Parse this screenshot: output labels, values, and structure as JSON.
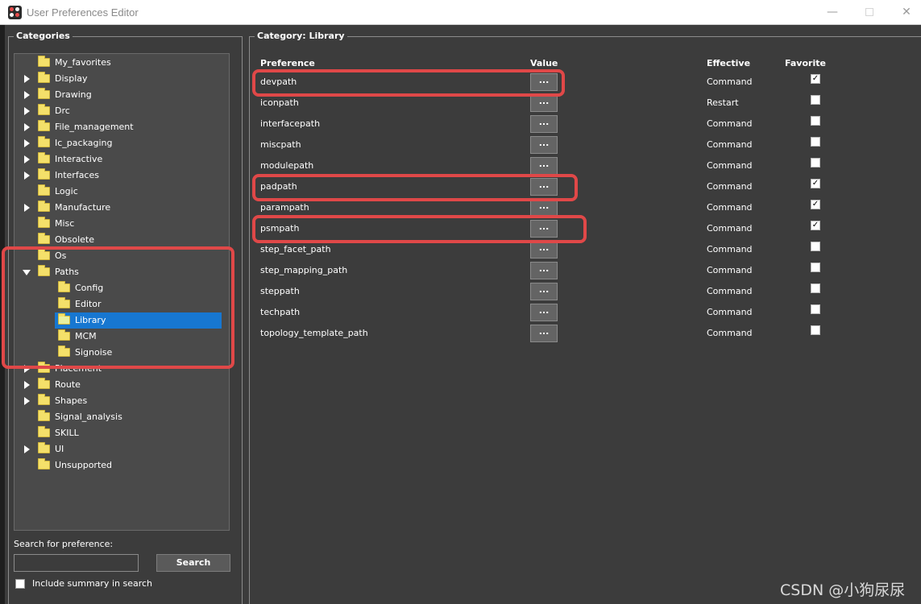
{
  "window": {
    "title": "User Preferences Editor",
    "minimize_glyph": "—",
    "close_glyph": "✕"
  },
  "categories_group": {
    "title": "Categories",
    "tree": [
      {
        "label": "My_favorites",
        "level": 0,
        "expander": "none"
      },
      {
        "label": "Display",
        "level": 0,
        "expander": "collapsed"
      },
      {
        "label": "Drawing",
        "level": 0,
        "expander": "collapsed"
      },
      {
        "label": "Drc",
        "level": 0,
        "expander": "collapsed"
      },
      {
        "label": "File_management",
        "level": 0,
        "expander": "collapsed"
      },
      {
        "label": "Ic_packaging",
        "level": 0,
        "expander": "collapsed"
      },
      {
        "label": "Interactive",
        "level": 0,
        "expander": "collapsed"
      },
      {
        "label": "Interfaces",
        "level": 0,
        "expander": "collapsed"
      },
      {
        "label": "Logic",
        "level": 0,
        "expander": "none"
      },
      {
        "label": "Manufacture",
        "level": 0,
        "expander": "collapsed"
      },
      {
        "label": "Misc",
        "level": 0,
        "expander": "none"
      },
      {
        "label": "Obsolete",
        "level": 0,
        "expander": "none"
      },
      {
        "label": "Os",
        "level": 0,
        "expander": "none"
      },
      {
        "label": "Paths",
        "level": 0,
        "expander": "expanded"
      },
      {
        "label": "Config",
        "level": 1,
        "expander": "none"
      },
      {
        "label": "Editor",
        "level": 1,
        "expander": "none"
      },
      {
        "label": "Library",
        "level": 1,
        "expander": "none",
        "selected": true
      },
      {
        "label": "MCM",
        "level": 1,
        "expander": "none"
      },
      {
        "label": "Signoise",
        "level": 1,
        "expander": "none"
      },
      {
        "label": "Placement",
        "level": 0,
        "expander": "collapsed"
      },
      {
        "label": "Route",
        "level": 0,
        "expander": "collapsed"
      },
      {
        "label": "Shapes",
        "level": 0,
        "expander": "collapsed"
      },
      {
        "label": "Signal_analysis",
        "level": 0,
        "expander": "none"
      },
      {
        "label": "SKILL",
        "level": 0,
        "expander": "none"
      },
      {
        "label": "UI",
        "level": 0,
        "expander": "collapsed"
      },
      {
        "label": "Unsupported",
        "level": 0,
        "expander": "none"
      }
    ],
    "search_label": "Search for preference:",
    "search_value": "",
    "search_button": "Search",
    "include_summary_label": "Include summary in search",
    "include_summary_checked": false
  },
  "category_group": {
    "title": "Category:  Library",
    "columns": {
      "preference": "Preference",
      "value": "Value",
      "effective": "Effective",
      "favorite": "Favorite"
    },
    "rows": [
      {
        "name": "devpath",
        "value_button": "...",
        "effective": "Command",
        "favorite": true,
        "highlighted": true
      },
      {
        "name": "iconpath",
        "value_button": "...",
        "effective": "Restart",
        "favorite": false
      },
      {
        "name": "interfacepath",
        "value_button": "...",
        "effective": "Command",
        "favorite": false
      },
      {
        "name": "miscpath",
        "value_button": "...",
        "effective": "Command",
        "favorite": false
      },
      {
        "name": "modulepath",
        "value_button": "...",
        "effective": "Command",
        "favorite": false
      },
      {
        "name": "padpath",
        "value_button": "...",
        "effective": "Command",
        "favorite": true,
        "highlighted": true
      },
      {
        "name": "parampath",
        "value_button": "...",
        "effective": "Command",
        "favorite": true
      },
      {
        "name": "psmpath",
        "value_button": "...",
        "effective": "Command",
        "favorite": true,
        "highlighted": true
      },
      {
        "name": "step_facet_path",
        "value_button": "...",
        "effective": "Command",
        "favorite": false
      },
      {
        "name": "step_mapping_path",
        "value_button": "...",
        "effective": "Command",
        "favorite": false
      },
      {
        "name": "steppath",
        "value_button": "...",
        "effective": "Command",
        "favorite": false
      },
      {
        "name": "techpath",
        "value_button": "...",
        "effective": "Command",
        "favorite": false
      },
      {
        "name": "topology_template_path",
        "value_button": "...",
        "effective": "Command",
        "favorite": false
      }
    ]
  },
  "watermark": "CSDN @小狗尿尿",
  "colors": {
    "background": "#3c3c3c",
    "tree_background": "#4a4a4a",
    "selection": "#1777d1",
    "highlight_box": "#e04848",
    "folder": "#f4e06a"
  }
}
